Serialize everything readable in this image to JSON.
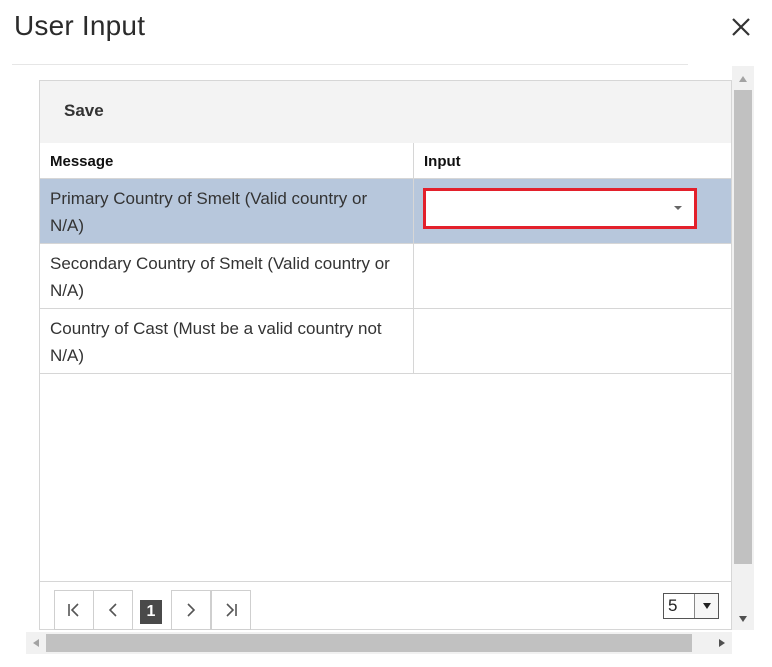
{
  "dialog": {
    "title": "User Input",
    "close_icon": "close-icon"
  },
  "toolbar": {
    "save_label": "Save"
  },
  "grid": {
    "columns": [
      "Message",
      "Input"
    ],
    "rows": [
      {
        "message": "Primary Country of Smelt (Valid country or N/A)",
        "input": "",
        "selected": true,
        "editor": "dropdown"
      },
      {
        "message": "Secondary Country of Smelt (Valid country or N/A)",
        "input": "",
        "selected": false
      },
      {
        "message": "Country of Cast (Must be a valid country not N/A)",
        "input": "",
        "selected": false
      }
    ]
  },
  "pager": {
    "current_page": "1",
    "page_size": "5",
    "icons": [
      "first-page-icon",
      "prev-page-icon",
      "next-page-icon",
      "last-page-icon"
    ]
  },
  "colors": {
    "selected_row": "#b7c7dc",
    "highlight_border": "#e3202b",
    "toolbar_bg": "#f3f3f3",
    "active_page": "#4a4a4a"
  }
}
